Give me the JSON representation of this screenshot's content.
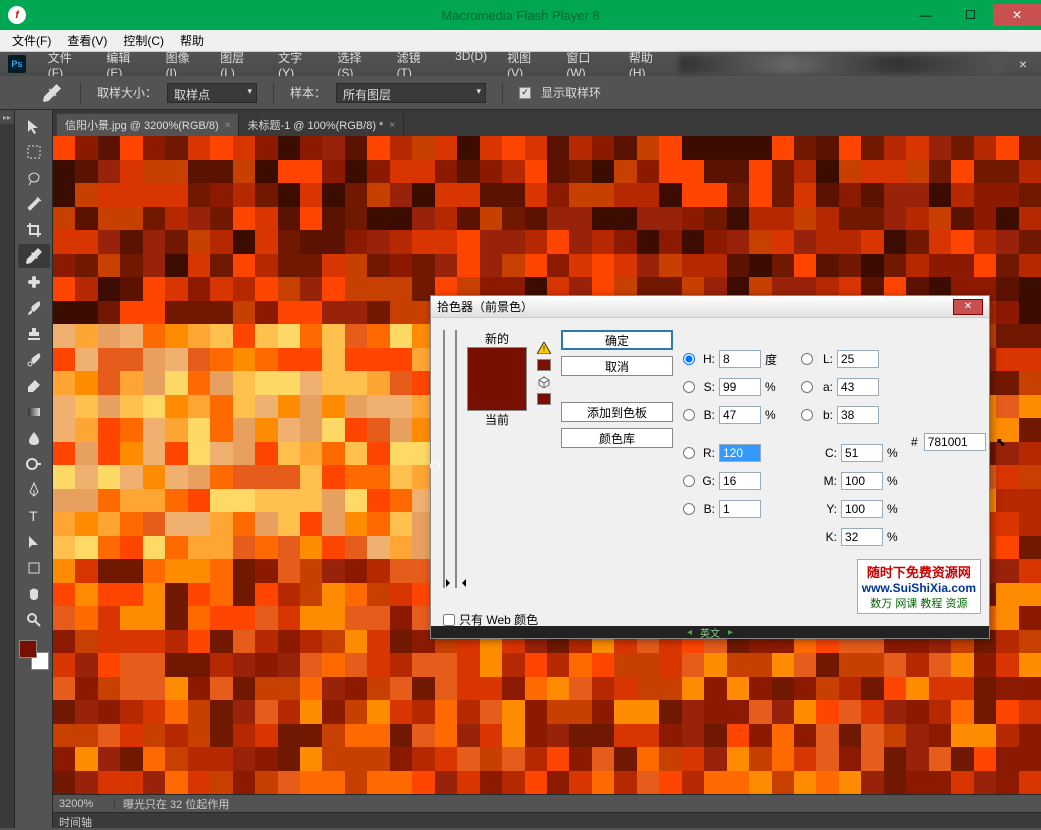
{
  "flash": {
    "title": "Macromedia Flash Player 8",
    "menu": [
      "文件(F)",
      "查看(V)",
      "控制(C)",
      "帮助"
    ]
  },
  "ps": {
    "menu": [
      "文件(F)",
      "编辑(E)",
      "图像(I)",
      "图层(L)",
      "文字(Y)",
      "选择(S)",
      "滤镜(T)",
      "3D(D)",
      "视图(V)",
      "窗口(W)",
      "帮助(H)"
    ],
    "options": {
      "sample_size_label": "取样大小：",
      "sample_size_value": "取样点",
      "sample_label": "样本：",
      "sample_value": "所有图层",
      "show_ring": "显示取样环"
    },
    "tabs": [
      {
        "label": "信阳小景.jpg @ 3200%(RGB/8)",
        "active": true
      },
      {
        "label": "未标题-1 @ 100%(RGB/8) *",
        "active": false
      }
    ],
    "status": {
      "zoom": "3200%",
      "msg": "曝光只在 32 位起作用",
      "timeline": "时间轴"
    }
  },
  "color_picker": {
    "title": "拾色器（前景色）",
    "new_label": "新的",
    "current_label": "当前",
    "buttons": {
      "ok": "确定",
      "cancel": "取消",
      "add": "添加到色板",
      "library": "颜色库"
    },
    "hsb": {
      "H": "8",
      "S": "99",
      "B": "47"
    },
    "lab": {
      "L": "25",
      "a": "43",
      "b": "38"
    },
    "rgb": {
      "R": "120",
      "G": "16",
      "B": "1"
    },
    "cmyk": {
      "C": "51",
      "M": "100",
      "Y": "100",
      "K": "32"
    },
    "hex": "781001",
    "web_only": "只有 Web 颜色",
    "degree": "度"
  },
  "watermark": {
    "line1": "随时下免费资源网",
    "line2": "www.SuiShiXia.com",
    "line3": "数万 网课 教程 资源"
  },
  "taskbar": {
    "ime": "英文"
  }
}
